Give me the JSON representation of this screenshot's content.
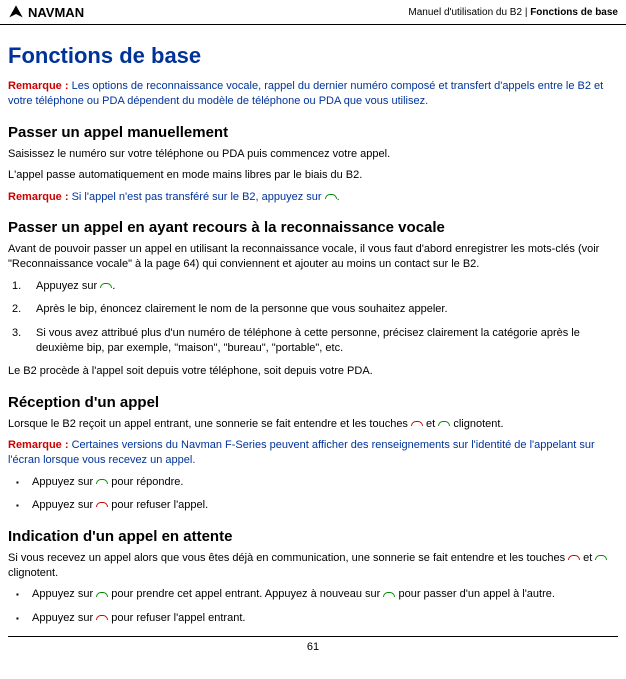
{
  "header": {
    "logo_text": "NAVMAN",
    "right_text_1": "Manuel d'utilisation du B2  |  ",
    "right_text_2": "Fonctions de base"
  },
  "h1": "Fonctions de base",
  "remarque1": {
    "label": "Remarque : ",
    "text": "Les options de reconnaissance vocale, rappel du dernier numéro composé et transfert d'appels entre le B2 et votre téléphone ou PDA dépendent du modèle de téléphone ou PDA que vous utilisez."
  },
  "section1": {
    "title": "Passer un appel manuellement",
    "p1": "Saisissez le numéro sur votre téléphone ou PDA puis commencez votre appel.",
    "p2": "L'appel passe automatiquement en mode mains libres par le biais du B2."
  },
  "remarque2": {
    "label": "Remarque : ",
    "text_before": "Si l'appel n'est pas transféré sur le B2, appuyez sur ",
    "text_after": "."
  },
  "section2": {
    "title": "Passer un appel en ayant recours à la reconnaissance vocale",
    "intro": "Avant de pouvoir passer un appel en utilisant la reconnaissance vocale, il vous faut d'abord enregistrer les mots-clés (voir \"Reconnaissance vocale\" à la page 64) qui conviennent et ajouter au moins un contact sur le B2.",
    "li1_before": "Appuyez sur ",
    "li1_after": ".",
    "li2": "Après le bip, énoncez clairement le nom de la personne que vous souhaitez appeler.",
    "li3": "Si vous avez attribué plus d'un numéro de téléphone à cette personne, précisez clairement la catégorie après le deuxième bip, par exemple, \"maison\", \"bureau\", \"portable\", etc.",
    "outro": "Le B2 procède à l'appel soit depuis votre téléphone, soit depuis votre PDA."
  },
  "section3": {
    "title": "Réception d'un appel",
    "p1_before": "Lorsque le B2 reçoit un appel entrant, une sonnerie se fait entendre et les touches  ",
    "p1_mid": " et ",
    "p1_after": " clignotent."
  },
  "remarque3": {
    "label": "Remarque : ",
    "text": "Certaines versions du Navman F-Series peuvent afficher des renseignements sur l'identité de l'appelant sur l'écran lorsque vous recevez un appel."
  },
  "section3_list": {
    "li1_before": "Appuyez sur ",
    "li1_after": " pour répondre.",
    "li2_before": "Appuyez sur ",
    "li2_after": " pour refuser l'appel."
  },
  "section4": {
    "title": "Indication d'un appel en attente",
    "p1_before": "Si vous recevez un appel alors que vous êtes déjà en communication, une sonnerie se fait entendre et les touches ",
    "p1_mid": " et ",
    "p1_after": " clignotent.",
    "li1_before": "Appuyez sur ",
    "li1_mid": " pour prendre cet appel entrant. Appuyez à nouveau sur ",
    "li1_after": " pour passer d'un appel à l'autre.",
    "li2_before": "Appuyez sur ",
    "li2_after": " pour refuser l'appel entrant."
  },
  "page_number": "61"
}
